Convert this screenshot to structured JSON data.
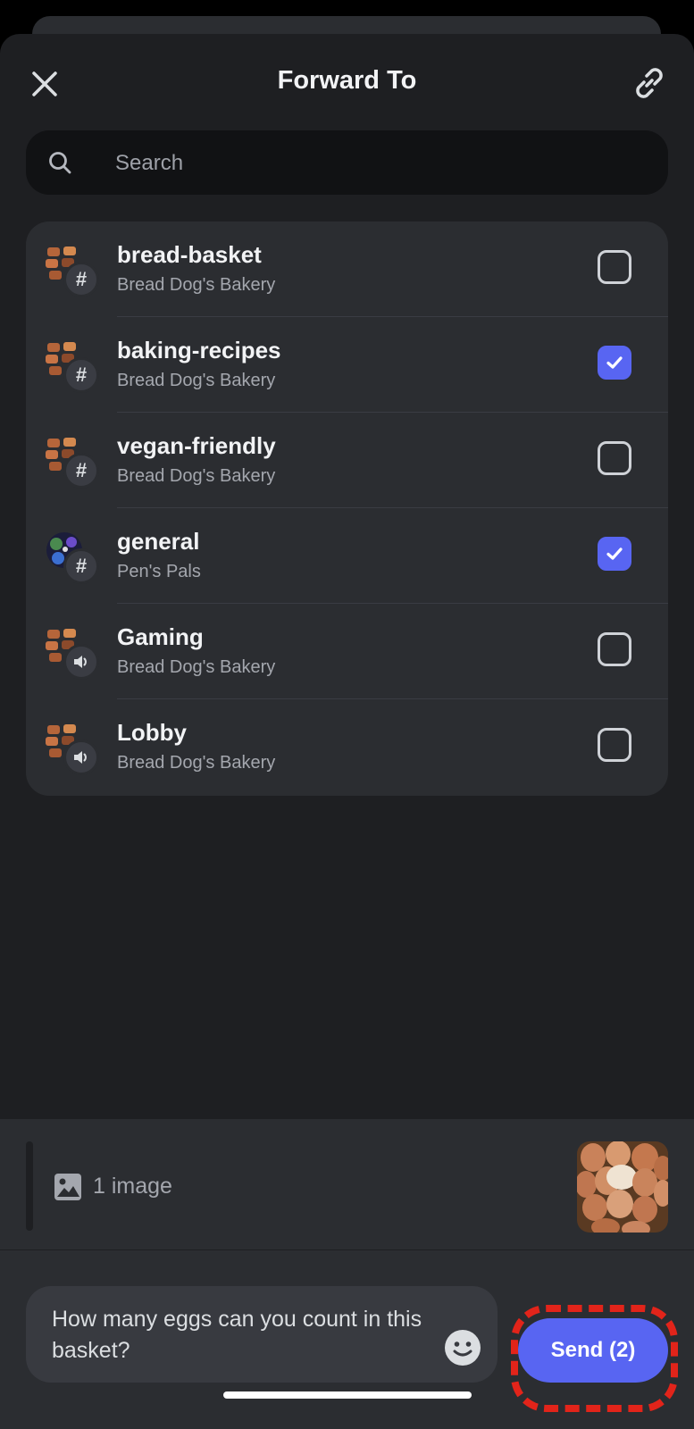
{
  "header": {
    "title": "Forward To",
    "close_icon": "close-icon",
    "link_icon": "link-icon"
  },
  "search": {
    "placeholder": "Search",
    "value": ""
  },
  "channels": [
    {
      "name": "bread-basket",
      "server": "Bread Dog's Bakery",
      "type": "text",
      "type_glyph": "#",
      "checked": false
    },
    {
      "name": "baking-recipes",
      "server": "Bread Dog's Bakery",
      "type": "text",
      "type_glyph": "#",
      "checked": true
    },
    {
      "name": "vegan-friendly",
      "server": "Bread Dog's Bakery",
      "type": "text",
      "type_glyph": "#",
      "checked": false
    },
    {
      "name": "general",
      "server": "Pen's Pals",
      "type": "text",
      "type_glyph": "#",
      "checked": true
    },
    {
      "name": "Gaming",
      "server": "Bread Dog's Bakery",
      "type": "voice",
      "type_glyph": "",
      "checked": false
    },
    {
      "name": "Lobby",
      "server": "Bread Dog's Bakery",
      "type": "voice",
      "type_glyph": "",
      "checked": false
    }
  ],
  "attachment": {
    "label": "1 image",
    "icon": "image-icon",
    "thumbnail": "basket of brown eggs"
  },
  "message": {
    "value": "How many eggs can you count in this basket?",
    "emoji_icon": "emoji-icon"
  },
  "send": {
    "label": "Send (2)"
  },
  "colors": {
    "accent": "#5865f2",
    "highlight": "#e2241a",
    "background": "#1e1f22",
    "surface": "#2b2d31"
  }
}
